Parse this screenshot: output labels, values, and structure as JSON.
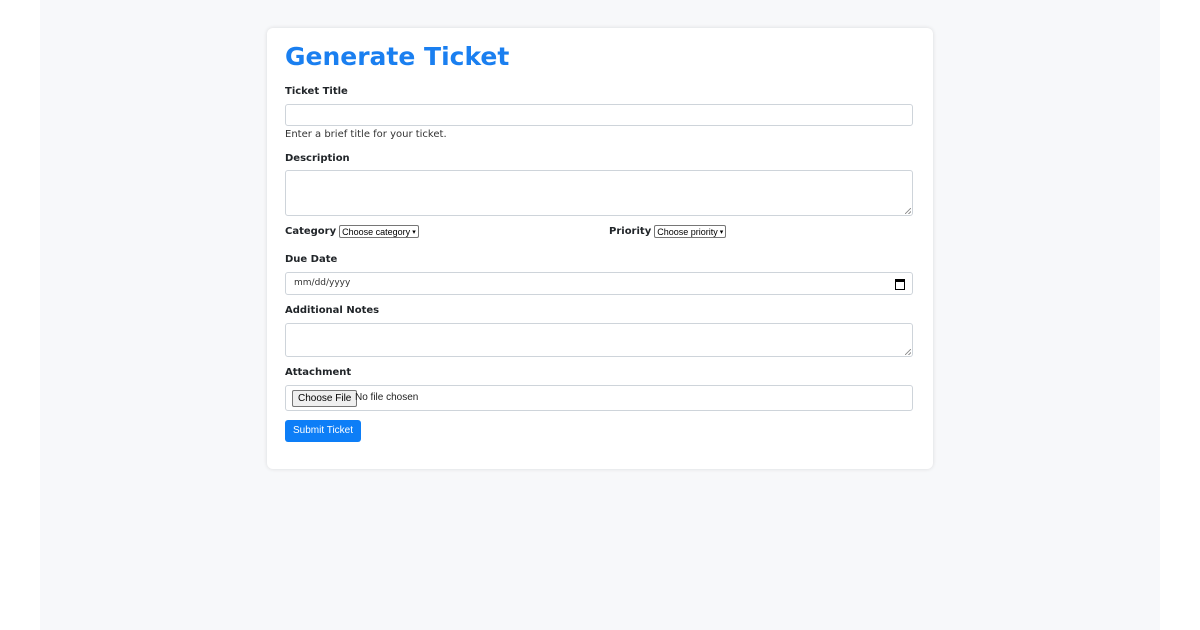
{
  "form": {
    "title": "Generate Ticket",
    "ticket_title": {
      "label": "Ticket Title",
      "value": "",
      "help": "Enter a brief title for your ticket."
    },
    "description": {
      "label": "Description",
      "value": ""
    },
    "category": {
      "label": "Category",
      "selected": "Choose category"
    },
    "priority": {
      "label": "Priority",
      "selected": "Choose priority"
    },
    "due_date": {
      "label": "Due Date",
      "placeholder": "mm/dd/yyyy"
    },
    "additional_notes": {
      "label": "Additional Notes",
      "value": ""
    },
    "attachment": {
      "label": "Attachment",
      "button_label": "Choose File",
      "status": "No file chosen"
    },
    "submit_label": "Submit Ticket"
  },
  "colors": {
    "accent": "#1a7ff0",
    "button": "#0d7ef7",
    "page_background": "#f7f8fa"
  },
  "icons": {
    "due_date": "calendar-icon",
    "select": "chevron-down-icon"
  }
}
